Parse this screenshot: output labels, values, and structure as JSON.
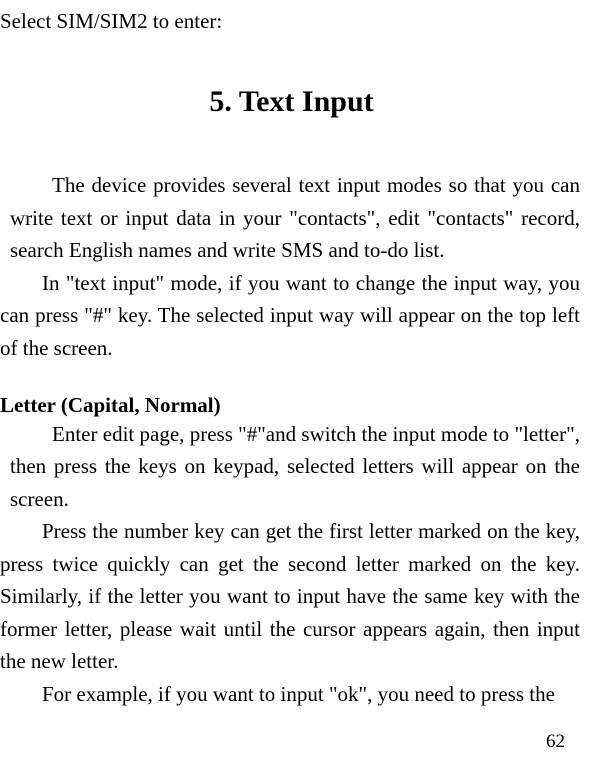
{
  "topLine": "Select SIM/SIM2 to enter:",
  "chapterHeading": "5.   Text Input",
  "para1": "The device provides several text input modes so that you can write text or input data in your \"contacts\", edit \"contacts\" record, search English names and write SMS and to-do list.",
  "para2": "In \"text input\" mode, if you want to change the input way, you can press \"#\" key. The selected input way will appear on the top left of the screen.",
  "sectionHeading": "Letter (Capital, Normal)",
  "para3": "Enter edit page, press \"#\"and switch the input mode to \"letter\", then press the keys on keypad, selected letters will appear on the screen.",
  "para4": "Press the number key can get the first letter marked on the key, press twice quickly can get the second letter marked on the key. Similarly, if the letter you want to input have the same key with the former letter, please wait until the cursor appears again, then input the new letter.",
  "para5": "For example, if you want to input \"ok\", you need to press the",
  "pageNumber": "62"
}
